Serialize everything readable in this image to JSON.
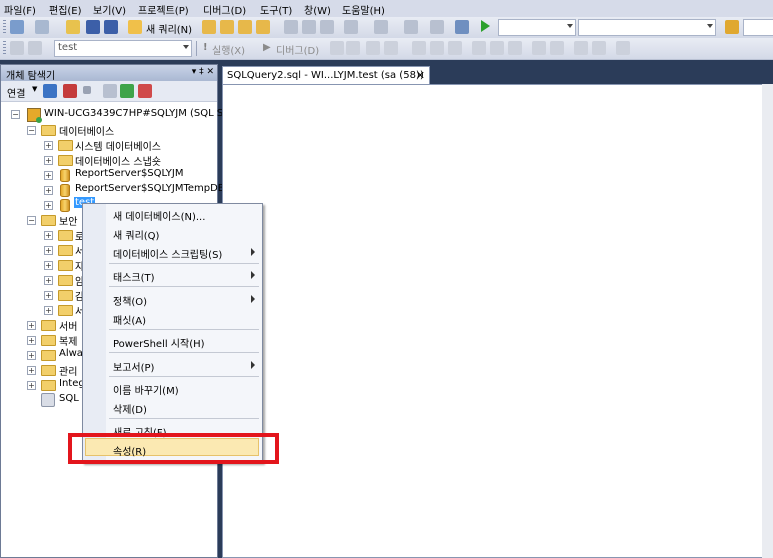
{
  "menubar": {
    "items": [
      "파일(F)",
      "편집(E)",
      "보기(V)",
      "프로젝트(P)",
      "디버그(D)",
      "도구(T)",
      "창(W)",
      "도움말(H)"
    ]
  },
  "toolbar1": {
    "new_query_label": "새 쿼리(N)"
  },
  "toolbar2": {
    "db_combo_value": "test",
    "execute_label": "실행(X)",
    "debug_label": "디버그(D)"
  },
  "object_explorer": {
    "title": "개체 탐색기",
    "header_buttons": "▾ ‡ ✕",
    "connect_label": "연결",
    "nodes": {
      "server": "WIN-UCG3439C7HP#SQLYJM (SQL S",
      "databases": "데이터베이스",
      "system_db": "시스템 데이터베이스",
      "db_snapshot": "데이터베이스 스냅숏",
      "report_server": "ReportServer$SQLYJM",
      "report_server_temp": "ReportServer$SQLYJMTempDB",
      "test": "test",
      "security": "보안",
      "sub1": "로",
      "sub2": "서",
      "sub3": "자",
      "sub4": "암",
      "sub5": "감",
      "sub6": "서",
      "server_objects": "서버",
      "replication": "복제",
      "always_on": "Alway",
      "management": "관리",
      "integration": "Integ",
      "sql_agent": "SQL"
    }
  },
  "document_tab": {
    "label": "SQLQuery2.sql - WI...LYJM.test (sa (58))",
    "close": "✕"
  },
  "context_menu": {
    "items": [
      {
        "label": "새 데이터베이스(N)..."
      },
      {
        "label": "새 쿼리(Q)"
      },
      {
        "label": "데이터베이스 스크립팅(S)"
      },
      {
        "label": "태스크(T)"
      },
      {
        "label": "정책(O)"
      },
      {
        "label": "패싯(A)"
      },
      {
        "label": "PowerShell 시작(H)"
      },
      {
        "label": "보고서(P)"
      },
      {
        "label": "이름 바꾸기(M)"
      },
      {
        "label": "삭제(D)"
      },
      {
        "label": "새로 고침(F)"
      },
      {
        "label": "속성(R)"
      }
    ]
  },
  "colors": {
    "highlight_box": "#e3151c",
    "menu_hover": "#fbe9b2"
  }
}
